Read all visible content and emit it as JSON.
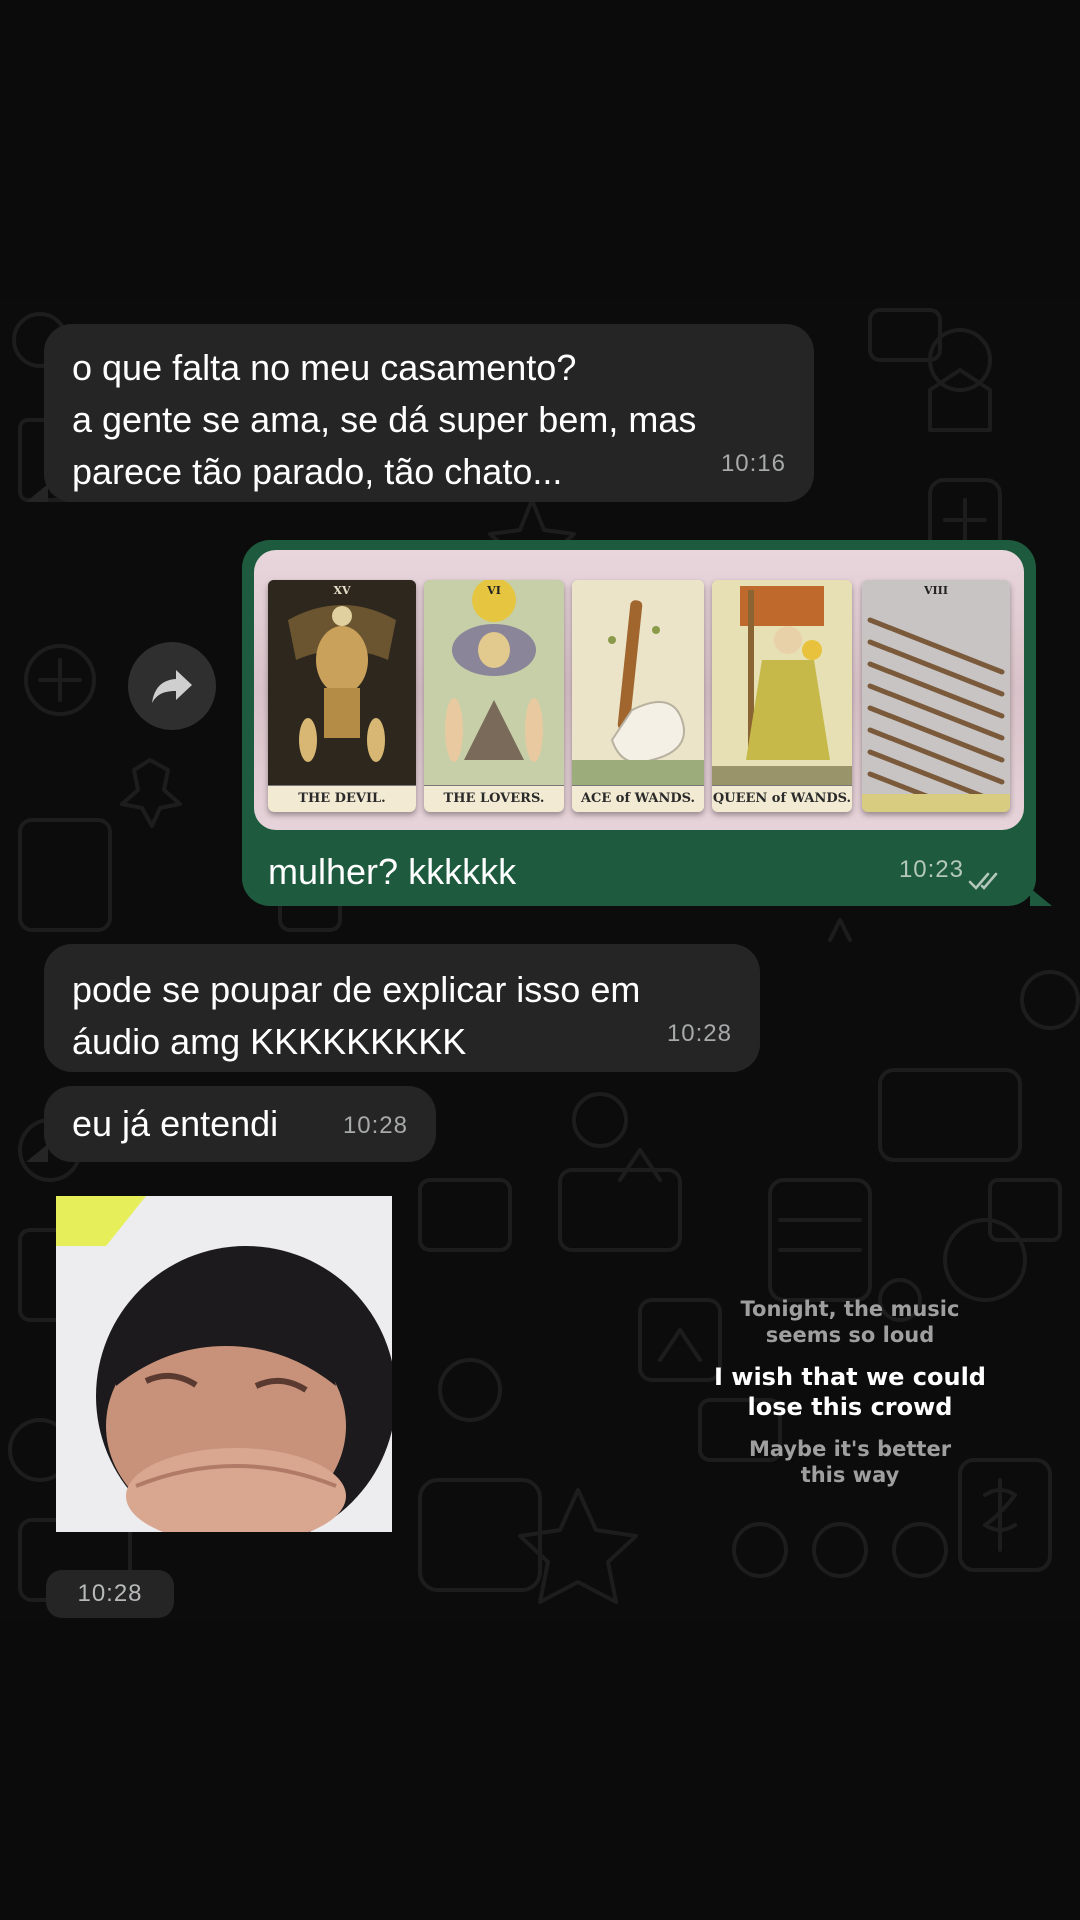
{
  "messages": [
    {
      "id": "m1",
      "direction": "incoming",
      "lines": [
        "o que falta no meu casamento?",
        "a gente se ama, se dá super bem, mas",
        "parece tão parado, tão chato..."
      ],
      "time": "10:16"
    },
    {
      "id": "m2",
      "direction": "outgoing",
      "image_cards": [
        "THE DEVIL.",
        "THE LOVERS.",
        "ACE of WANDS.",
        "QUEEN of WANDS.",
        ""
      ],
      "image_card_numerals": [
        "XV",
        "VI",
        "",
        "",
        "VIII"
      ],
      "caption": "mulher? kkkkkk",
      "time": "10:23",
      "status": "read"
    },
    {
      "id": "m3",
      "direction": "incoming",
      "lines": [
        "pode se poupar de explicar isso em",
        "áudio amg KKKKKKKKK"
      ],
      "time": "10:28"
    },
    {
      "id": "m4",
      "direction": "incoming",
      "lines": [
        "eu já entendi"
      ],
      "time": "10:28"
    },
    {
      "id": "m5",
      "direction": "incoming",
      "media": "video-thumbnail",
      "time": "10:28"
    }
  ],
  "lyrics": {
    "previous": [
      "Tonight, the music",
      "seems so loud"
    ],
    "current": [
      "I wish that we could",
      "lose this crowd"
    ],
    "next": [
      "Maybe it's better",
      "this way"
    ]
  },
  "colors": {
    "incoming_bubble": "#252525",
    "outgoing_bubble": "#1e5b3e",
    "background": "#0c0c0c",
    "time_text": "#a7a9aa"
  },
  "icons": {
    "forward": "forward-arrow-icon",
    "read_receipt": "double-check-icon"
  }
}
